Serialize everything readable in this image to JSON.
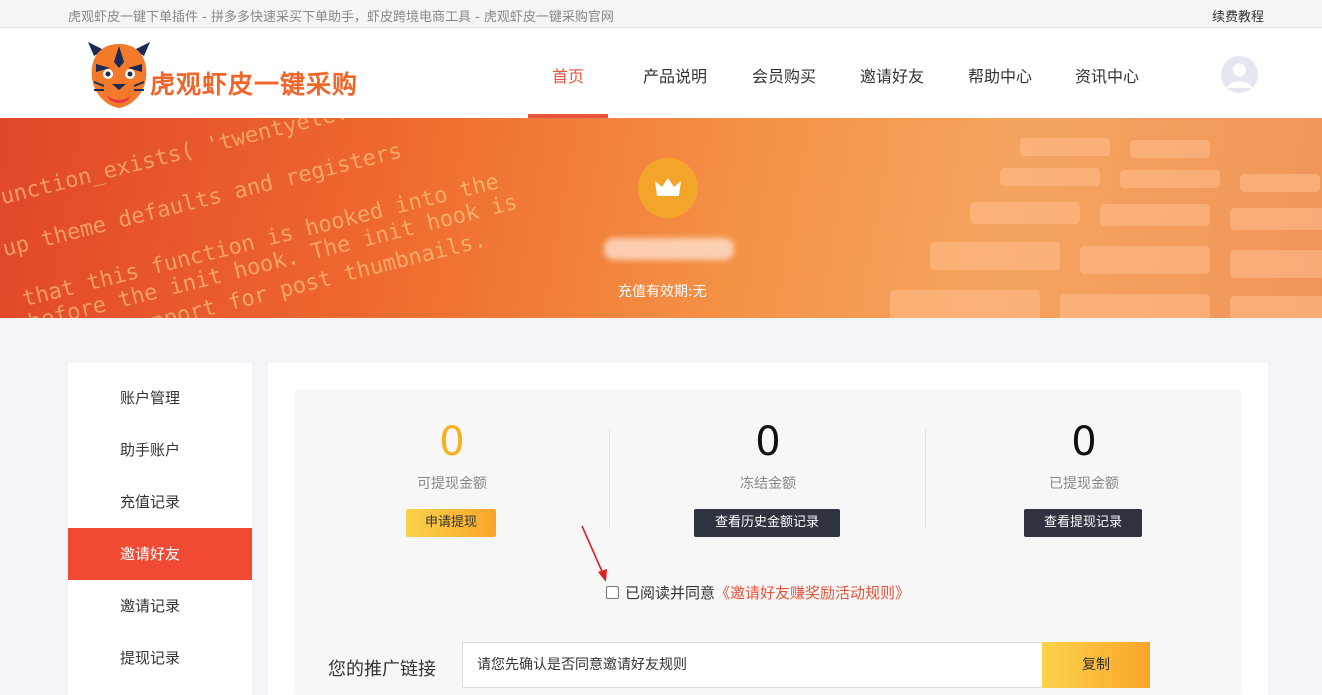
{
  "topbar": {
    "tagline": "虎观虾皮一键下单插件 - 拼多多快速采买下单助手，虾皮跨境电商工具 - 虎观虾皮一键采购官网",
    "renew_tutorial": "续费教程"
  },
  "header": {
    "brand": "虎观虾皮一键采购",
    "nav": [
      "首页",
      "产品说明",
      "会员购买",
      "邀请好友",
      "帮助中心",
      "资讯中心"
    ],
    "active_nav": "首页"
  },
  "banner": {
    "code_lines": [
      "unction_exists( 'twentyeleven_setup' )",
      "up theme defaults and registers",
      "that this function is hooked into the",
      "s before the init hook. The init hook is",
      "icating support for post thumbnails."
    ],
    "validity": "充值有效期:无"
  },
  "sidebar": {
    "items": [
      "账户管理",
      "助手账户",
      "充值记录",
      "邀请好友",
      "邀请记录",
      "提现记录"
    ],
    "active": "邀请好友"
  },
  "stats": [
    {
      "value": "0",
      "label": "可提现金额",
      "button": "申请提现"
    },
    {
      "value": "0",
      "label": "冻结金额",
      "button": "查看历史金额记录"
    },
    {
      "value": "0",
      "label": "已提现金额",
      "button": "查看提现记录"
    }
  ],
  "agreement": {
    "text": "已阅读并同意",
    "rules_link": "《邀请好友赚奖励活动规则》",
    "checked": false
  },
  "promo": {
    "label": "您的推广链接",
    "input_value": "请您先确认是否同意邀请好友规则",
    "copy_button": "复制"
  },
  "colors": {
    "accent": "#e8533a",
    "sidebar_active": "#f04a32",
    "yellow": "#f5b11f",
    "dark_button": "#2f323f"
  }
}
